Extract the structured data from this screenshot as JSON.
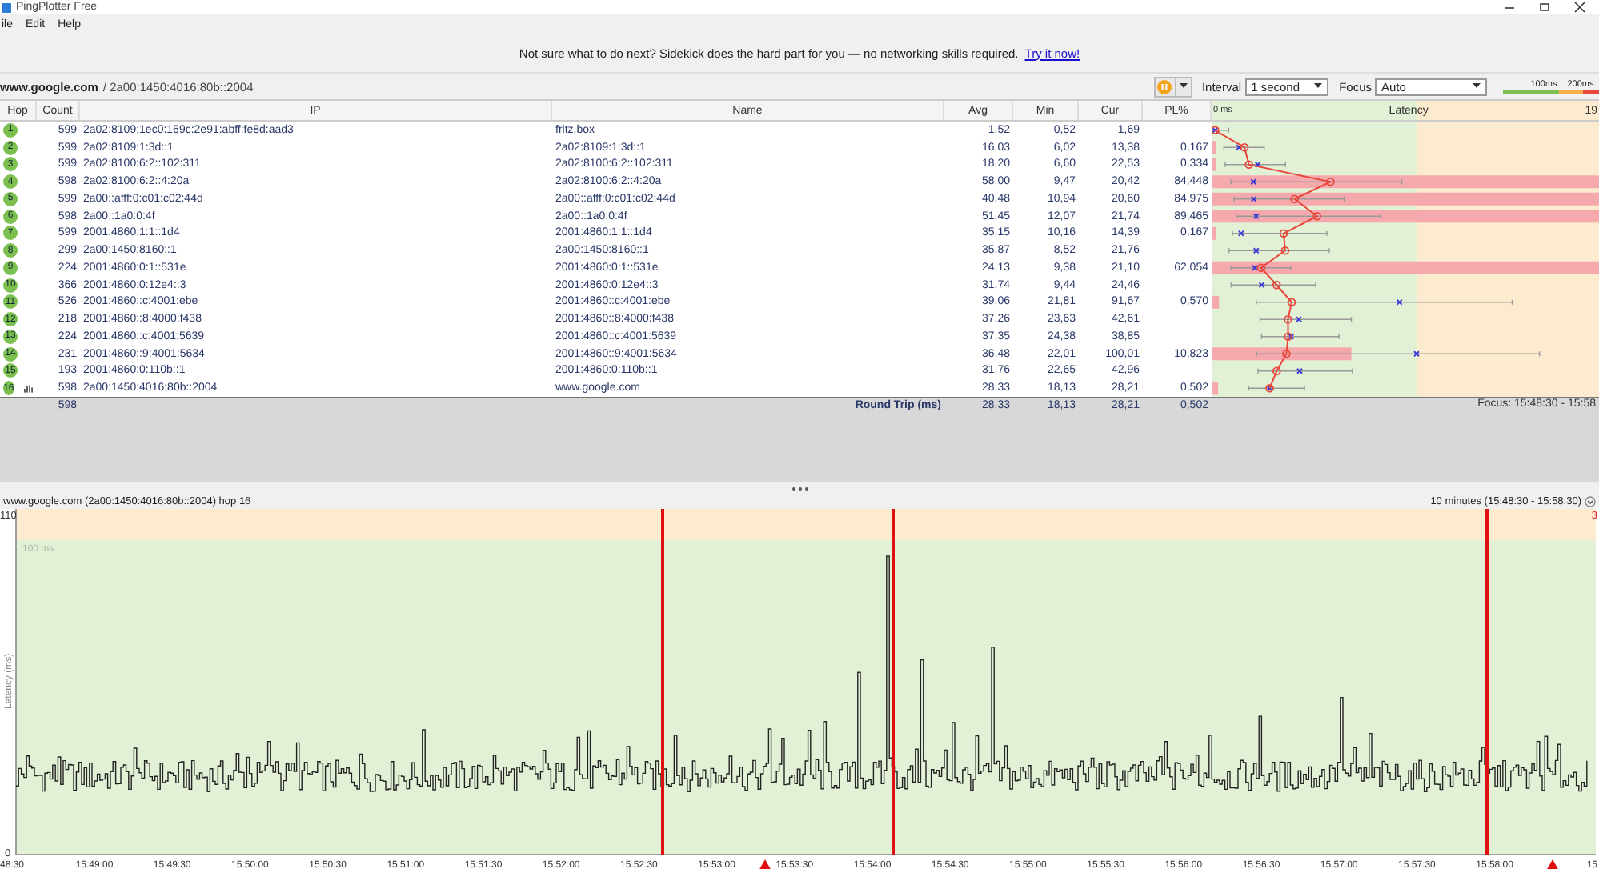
{
  "window": {
    "title": "PingPlotter Free"
  },
  "menu": [
    "ile",
    "Edit",
    "Help"
  ],
  "banner": {
    "text": "Not sure what to do next? Sidekick does the hard part for you — no networking skills required.",
    "link": "Try it now!"
  },
  "target": {
    "host": "www.google.com",
    "address": "/ 2a00:1450:4016:80b::2004"
  },
  "toolbar": {
    "interval_label": "Interval",
    "interval": "1 second",
    "focus_label": "Focus",
    "focus": "Auto",
    "scale_labels": [
      "100ms",
      "200ms"
    ]
  },
  "table": {
    "columns": [
      "Hop",
      "Count",
      "IP",
      "Name",
      "Avg",
      "Min",
      "Cur",
      "PL%"
    ],
    "latency_header": {
      "start": "0 ms",
      "title": "Latency",
      "end": "19"
    },
    "rows": [
      {
        "hop": "1",
        "count": "599",
        "ip": "2a02:8109:1ec0:169c:2e91:abff:fe8d:aad3",
        "name": "fritz.box",
        "avg": "1,52",
        "min": "0,52",
        "cur": "1,69",
        "graphed": false
      },
      {
        "hop": "2",
        "count": "599",
        "ip": "2a02:8109:1:3d::1",
        "name": "2a02:8109:1:3d::1",
        "avg": "16,03",
        "min": "6,02",
        "cur": "13,38",
        "pl": "0,167",
        "graphed": false
      },
      {
        "hop": "3",
        "count": "599",
        "ip": "2a02:8100:6:2::102:311",
        "name": "2a02:8100:6:2::102:311",
        "avg": "18,20",
        "min": "6,60",
        "cur": "22,53",
        "pl": "0,334",
        "graphed": false
      },
      {
        "hop": "4",
        "count": "598",
        "ip": "2a02:8100:6:2::4:20a",
        "name": "2a02:8100:6:2::4:20a",
        "avg": "58,00",
        "min": "9,47",
        "cur": "20,42",
        "pl": "84,448",
        "graphed": false
      },
      {
        "hop": "5",
        "count": "599",
        "ip": "2a00::afff:0:c01:c02:44d",
        "name": "2a00::afff:0:c01:c02:44d",
        "avg": "40,48",
        "min": "10,94",
        "cur": "20,60",
        "pl": "84,975",
        "graphed": false
      },
      {
        "hop": "6",
        "count": "598",
        "ip": "2a00::1a0:0:4f",
        "name": "2a00::1a0:0:4f",
        "avg": "51,45",
        "min": "12,07",
        "cur": "21,74",
        "pl": "89,465",
        "graphed": false
      },
      {
        "hop": "7",
        "count": "599",
        "ip": "2001:4860:1:1::1d4",
        "name": "2001:4860:1:1::1d4",
        "avg": "35,15",
        "min": "10,16",
        "cur": "14,39",
        "pl": "0,167",
        "graphed": false
      },
      {
        "hop": "8",
        "count": "299",
        "ip": "2a00:1450:8160::1",
        "name": "2a00:1450:8160::1",
        "avg": "35,87",
        "min": "8,52",
        "cur": "21,76",
        "graphed": false
      },
      {
        "hop": "9",
        "count": "224",
        "ip": "2001:4860:0:1::531e",
        "name": "2001:4860:0:1::531e",
        "avg": "24,13",
        "min": "9,38",
        "cur": "21,10",
        "pl": "62,054",
        "graphed": false
      },
      {
        "hop": "10",
        "count": "366",
        "ip": "2001:4860:0:12e4::3",
        "name": "2001:4860:0:12e4::3",
        "avg": "31,74",
        "min": "9,44",
        "cur": "24,46",
        "graphed": false
      },
      {
        "hop": "11",
        "count": "526",
        "ip": "2001:4860::c:4001:ebe",
        "name": "2001:4860::c:4001:ebe",
        "avg": "39,06",
        "min": "21,81",
        "cur": "91,67",
        "pl": "0,570",
        "graphed": false
      },
      {
        "hop": "12",
        "count": "218",
        "ip": "2001:4860::8:4000:f438",
        "name": "2001:4860::8:4000:f438",
        "avg": "37,26",
        "min": "23,63",
        "cur": "42,61",
        "graphed": false
      },
      {
        "hop": "13",
        "count": "224",
        "ip": "2001:4860::c:4001:5639",
        "name": "2001:4860::c:4001:5639",
        "avg": "37,35",
        "min": "24,38",
        "cur": "38,85",
        "graphed": false
      },
      {
        "hop": "14",
        "count": "231",
        "ip": "2001:4860::9:4001:5634",
        "name": "2001:4860::9:4001:5634",
        "avg": "36,48",
        "min": "22,01",
        "cur": "100,01",
        "pl": "10,823",
        "graphed": false
      },
      {
        "hop": "15",
        "count": "193",
        "ip": "2001:4860:0:110b::1",
        "name": "2001:4860:0:110b::1",
        "avg": "31,76",
        "min": "22,65",
        "cur": "42,96",
        "graphed": false
      },
      {
        "hop": "16",
        "count": "598",
        "ip": "2a00:1450:4016:80b::2004",
        "name": "www.google.com",
        "avg": "28,33",
        "min": "18,13",
        "cur": "28,21",
        "pl": "0,502",
        "graphed": true
      }
    ]
  },
  "summary": {
    "count": "598",
    "label": "Round Trip (ms)",
    "avg": "28,33",
    "min": "18,13",
    "cur": "28,21",
    "pl": "0,502",
    "focus": "Focus: 15:48:30 - 15:58"
  },
  "graph": {
    "title": "www.google.com (2a00:1450:4016:80b::2004) hop 16",
    "range": "10 minutes (15:48:30 - 15:58:30)",
    "y_axis_label": "Latency (ms)",
    "y_ticks": [
      "110",
      "0"
    ],
    "band_label": "100 ms",
    "loss_axis_tick": "3",
    "x_ticks": [
      "48:30",
      "15:49:00",
      "15:49:30",
      "15:50:00",
      "15:50:30",
      "15:51:00",
      "15:51:30",
      "15:52:00",
      "15:52:30",
      "15:53:00",
      "15:53:30",
      "15:54:00",
      "15:54:30",
      "15:55:00",
      "15:55:30",
      "15:56:00",
      "15:56:30",
      "15:57:00",
      "15:57:30",
      "15:58:00",
      "15"
    ]
  }
}
